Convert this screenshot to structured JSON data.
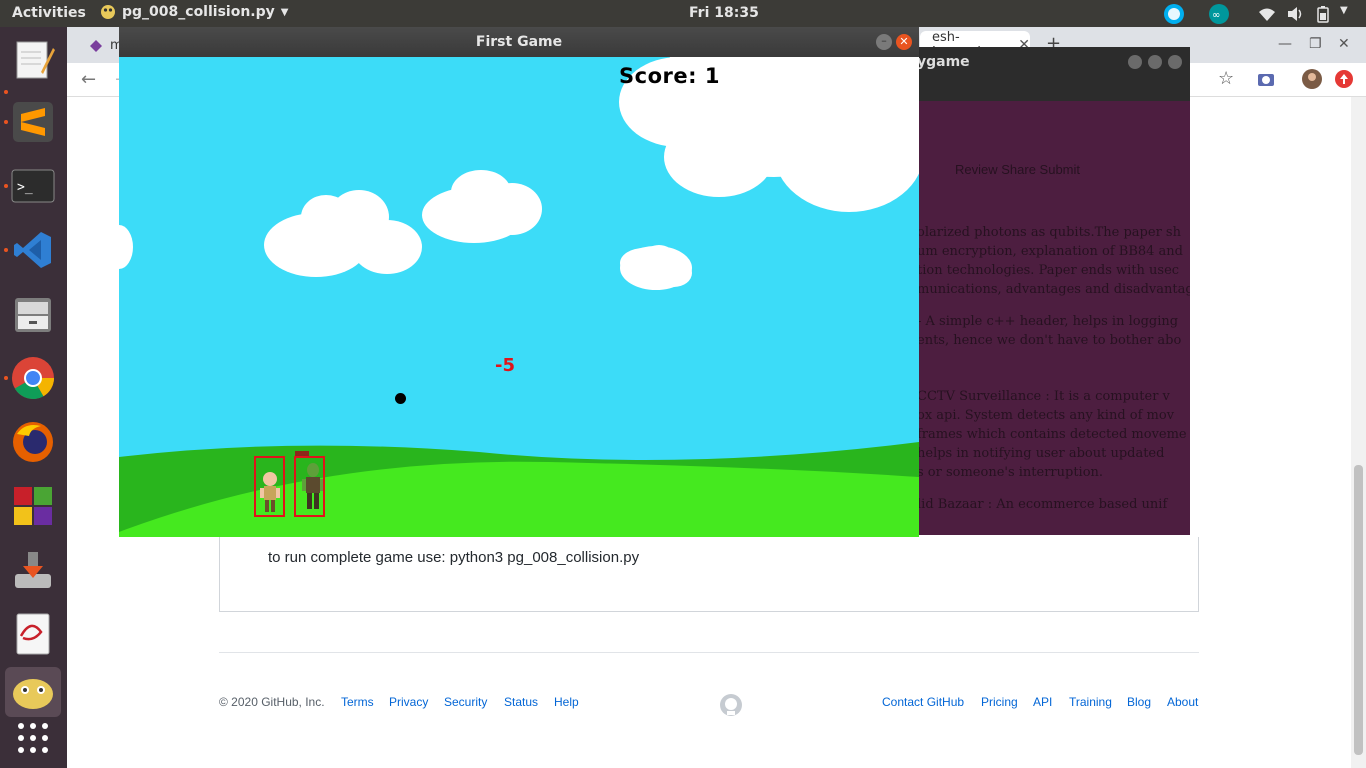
{
  "topbar": {
    "activities": "Activities",
    "app_name": "pg_008_collision.py",
    "clock": "Fri 18:35"
  },
  "browser": {
    "tab_partial_1": "m",
    "tab_partial_2": "esh-Jamgad",
    "new_tab": "+"
  },
  "second_window": {
    "title_partial": "ygame",
    "text_lines": [
      "Review     Share     Submit",
      "olarized photons as qubits.The paper sh",
      "um encryption, explanation of BB84 and",
      "tion technologies.  Paper ends with usec",
      "munications, advantages and disadvantag",
      "- A simple c++ header, helps in logging",
      "ents, hence we don't have to bother abo",
      "CCTV Surveillance : It is a computer v",
      "ox api. System detects any kind of mov",
      "frames which contains detected moveme",
      "helps in notifying user about updated",
      "s or someone's interruption.",
      "lid Bazaar : An ecommerce based unif"
    ]
  },
  "github": {
    "run_text": "to run complete game use: python3 pg_008_collision.py",
    "footer_left": {
      "copyright": "© 2020 GitHub, Inc.",
      "links": [
        "Terms",
        "Privacy",
        "Security",
        "Status",
        "Help"
      ]
    },
    "footer_right": {
      "links": [
        "Contact GitHub",
        "Pricing",
        "API",
        "Training",
        "Blog",
        "About"
      ]
    }
  },
  "game": {
    "window_title": "First Game",
    "score_label": "Score:",
    "score_value": "1",
    "hit_text": "-5",
    "colors": {
      "sky": "#3cdcf8",
      "hill_dark": "#29b51d",
      "hill_light": "#45e91f",
      "hitbox": "#e0141b"
    }
  }
}
